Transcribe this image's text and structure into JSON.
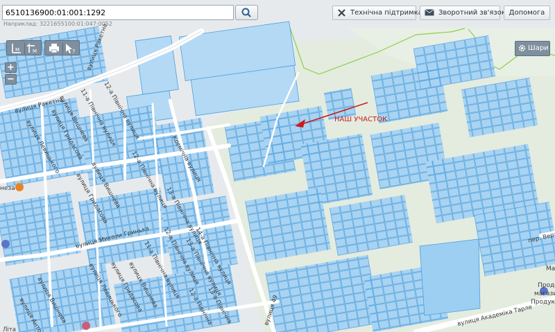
{
  "search": {
    "value": "6510136900:01:001:1292",
    "hint": "Наприклад: 3221655100:01:047:0052"
  },
  "toolbar": {
    "support": "Технічна підтримка",
    "feedback": "Зворотний зв'язок",
    "help": "Допомога"
  },
  "controls": {
    "layers": "Шари",
    "zoom_in": "+",
    "zoom_out": "−"
  },
  "annotation": {
    "text": "НАШ УЧАСТОК",
    "color": "#cc1a1a"
  },
  "colors": {
    "parcel_fill": "#a9d3f2",
    "parcel_stroke": "#4a9fe0",
    "road": "#ffffff",
    "field": "#e6efe0",
    "boundary": "#8bd04a"
  },
  "streets": {
    "raketna_top": "вулиця Ракетна",
    "raketna_left": "вулиця Ракетна",
    "levytskoho_1": "вулиця Левицького",
    "vyshneva_1": "вулиця Вишнева",
    "hrydasova_1": "вулиця Гридасова",
    "pivnichna_11_1": "11-а Північна вулиця",
    "pivnichna_12_1": "12-а Північна вулиця",
    "kosmichna": "Космічна вулиця",
    "vyshneva_2": "вулиця Вишнева",
    "hrydasova_2": "вулиця Гридасова",
    "pivnichna_12_2": "12-а Північна вулиця",
    "pivnichna_13_1": "13-а Північна вулиця",
    "hrynka": "вулиця Миколи Гринька",
    "pivnichna_11_2": "11-а Північна вулиця",
    "pivnichna_12_3": "12-а Північна вулиця",
    "pivnichna_13_2": "13-а Північна вулиця",
    "pivnichna_14": "14-а Північна вулиця",
    "vyshneva_3": "вулиця Вишнева",
    "hrydasova_3": "вулиця Гридасова",
    "levytskoho_2": "вулиця Левицького",
    "antonova": "вулиця Антонова",
    "vyshneva_4": "вулиця Вишнева",
    "vulytsia_49": "вулиця 49",
    "tarle": "вулиця Академіка Тарле",
    "vertolitna": "пер. Вертол",
    "pivnichna_12_4": "12-а Північна",
    "pivnichna_13_3": "13-а Північна",
    "lita": "Літа"
  },
  "pois": {
    "poi_left": "неза",
    "poi_right": "Ма",
    "shop_1": "Продов",
    "shop_2": "магазин",
    "shop_3": "Продукт"
  }
}
